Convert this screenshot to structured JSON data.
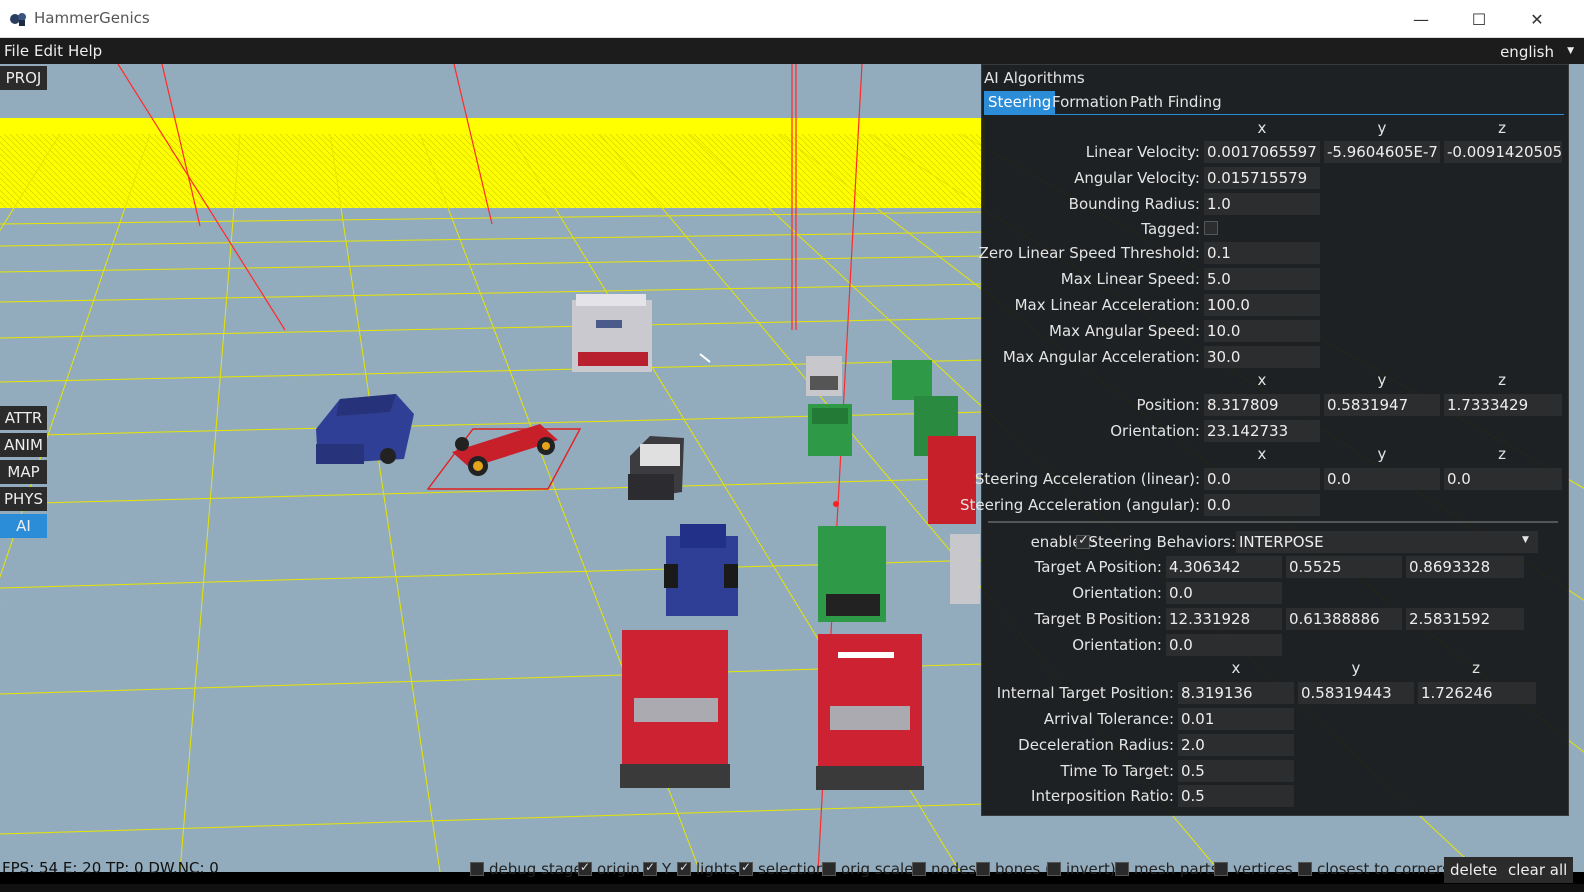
{
  "window": {
    "title": "HammerGenics",
    "min_glyph": "—",
    "max_glyph": "☐",
    "close_glyph": "✕"
  },
  "menu": {
    "items": [
      "File",
      "Edit",
      "Help"
    ],
    "language": "english",
    "language_arrow": "▼"
  },
  "side_buttons": {
    "proj": "PROJ",
    "attr": "ATTR",
    "anim": "ANIM",
    "map": "MAP",
    "phys": "PHYS",
    "ai": "AI"
  },
  "ai_panel": {
    "title": "AI Algorithms",
    "tabs": [
      "Steering",
      "Formation",
      "Path Finding"
    ],
    "axes": {
      "x": "x",
      "y": "y",
      "z": "z"
    },
    "linear_velocity": {
      "label": "Linear Velocity:",
      "x": "0.0017065597",
      "y": "-5.9604605E-7",
      "z": "-0.0091420505"
    },
    "angular_velocity": {
      "label": "Angular Velocity:",
      "value": "0.015715579"
    },
    "bounding_radius": {
      "label": "Bounding Radius:",
      "value": "1.0"
    },
    "tagged": {
      "label": "Tagged:",
      "checked": false
    },
    "zero_linear_speed_threshold": {
      "label": "Zero Linear Speed Threshold:",
      "value": "0.1"
    },
    "max_linear_speed": {
      "label": "Max Linear Speed:",
      "value": "5.0"
    },
    "max_linear_acceleration": {
      "label": "Max Linear Acceleration:",
      "value": "100.0"
    },
    "max_angular_speed": {
      "label": "Max Angular Speed:",
      "value": "10.0"
    },
    "max_angular_acceleration": {
      "label": "Max Angular Acceleration:",
      "value": "30.0"
    },
    "position": {
      "label": "Position:",
      "x": "8.317809",
      "y": "0.5831947",
      "z": "1.7333429"
    },
    "orientation": {
      "label": "Orientation:",
      "value": "23.142733"
    },
    "steering_accel_linear": {
      "label": "Steering Acceleration (linear):",
      "x": "0.0",
      "y": "0.0",
      "z": "0.0"
    },
    "steering_accel_angular": {
      "label": "Steering Acceleration (angular):",
      "value": "0.0"
    },
    "enabled": {
      "label": "enabled:",
      "checked": true
    },
    "steering_behaviors": {
      "label": "Steering Behaviors:",
      "value": "INTERPOSE",
      "arrow": "▼"
    },
    "target_a": {
      "label": "Target A",
      "position_label": "Position:",
      "x": "4.306342",
      "y": "0.5525",
      "z": "0.8693328",
      "orientation_label": "Orientation:",
      "orientation": "0.0"
    },
    "target_b": {
      "label": "Target B",
      "position_label": "Position:",
      "x": "12.331928",
      "y": "0.61388886",
      "z": "2.5831592",
      "orientation_label": "Orientation:",
      "orientation": "0.0"
    },
    "internal_target_position": {
      "label": "Internal Target Position:",
      "x": "8.319136",
      "y": "0.58319443",
      "z": "1.726246"
    },
    "arrival_tolerance": {
      "label": "Arrival Tolerance:",
      "value": "0.01"
    },
    "deceleration_radius": {
      "label": "Deceleration Radius:",
      "value": "2.0"
    },
    "time_to_target": {
      "label": "Time To Target:",
      "value": "0.5"
    },
    "interposition_ratio": {
      "label": "Interposition Ratio:",
      "value": "0.5"
    }
  },
  "status": {
    "fps": "FPS: 54 E: 20 TP: 0 DW.NC: 0",
    "toggles": [
      {
        "label": "debug stage",
        "checked": false
      },
      {
        "label": "origin",
        "checked": true
      },
      {
        "label": "Y",
        "checked": true
      },
      {
        "label": "lights",
        "checked": true
      },
      {
        "label": "selection",
        "checked": true
      },
      {
        "label": "orig scale",
        "checked": false
      },
      {
        "label": "nodes",
        "checked": false
      },
      {
        "label": "bones (",
        "checked": false
      },
      {
        "label": "invert)",
        "checked": false
      },
      {
        "label": "mesh parts",
        "checked": false
      },
      {
        "label": "vertices (",
        "checked": false
      },
      {
        "label": "closest to corners)",
        "checked": false
      }
    ],
    "delete_label": "delete",
    "clear_all_label": "clear all"
  },
  "colors": {
    "accent": "#2b8cd8",
    "sky": "#93acbd",
    "horizon": "#ffff00",
    "grid": "#e8e800",
    "axis": "#ff2020"
  }
}
